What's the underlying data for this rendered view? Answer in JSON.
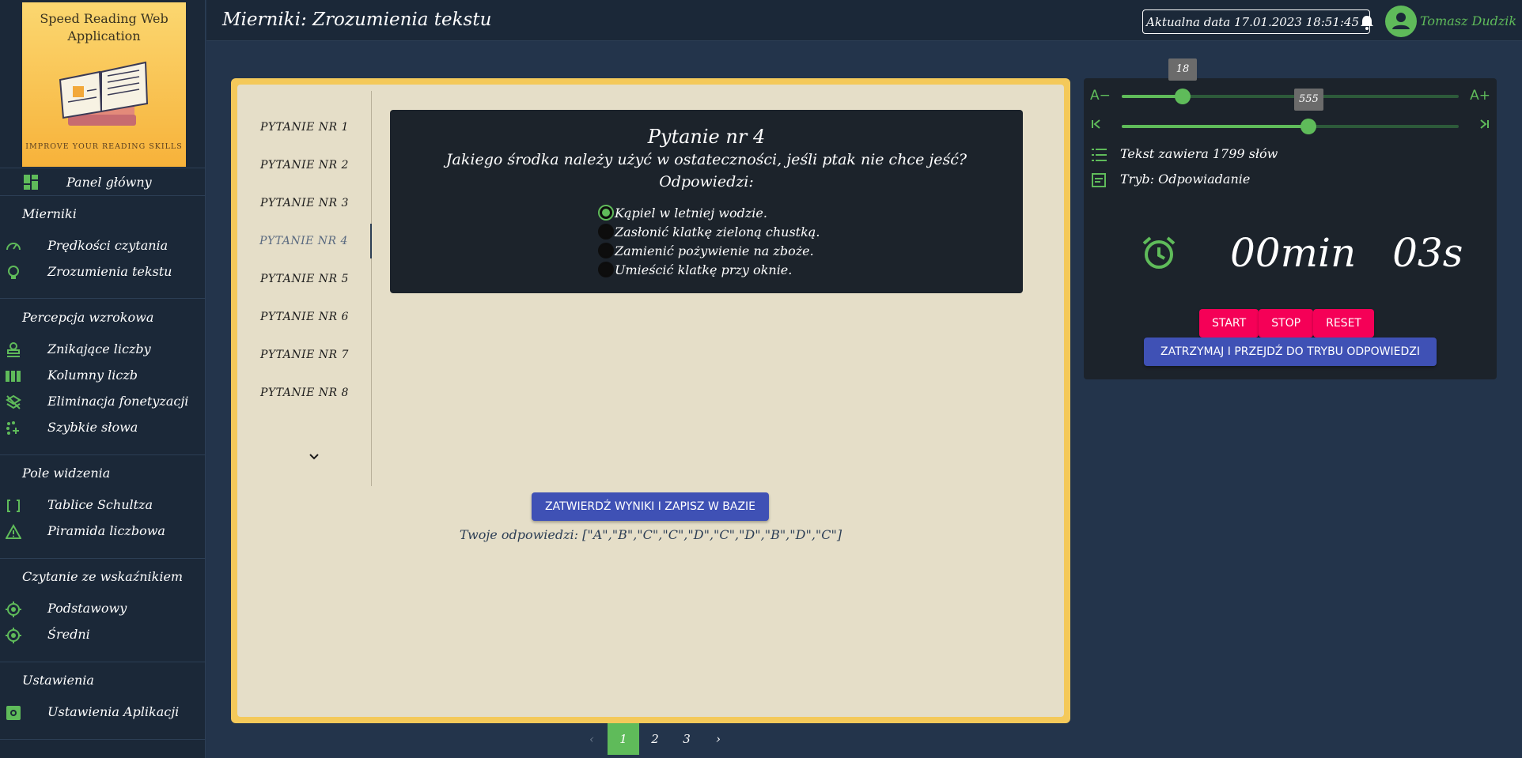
{
  "app": {
    "logo_title": "Speed Reading Web Application",
    "logo_tagline": "IMPROVE YOUR READING SKILLS"
  },
  "header": {
    "title": "Mierniki: Zrozumienia tekstu",
    "date_label": "Aktualna data 17.01.2023 18:51:45",
    "user_name": "Tomasz Dudzik"
  },
  "sidebar": {
    "main_label": "Panel główny",
    "sections": [
      {
        "title": "Mierniki",
        "items": [
          "Prędkości czytania",
          "Zrozumienia tekstu"
        ]
      },
      {
        "title": "Percepcja wzrokowa",
        "items": [
          "Znikające liczby",
          "Kolumny liczb",
          "Eliminacja fonetyzacji",
          "Szybkie słowa"
        ]
      },
      {
        "title": "Pole widzenia",
        "items": [
          "Tablice Schultza",
          "Piramida liczbowa"
        ]
      },
      {
        "title": "Czytanie ze wskaźnikiem",
        "items": [
          "Podstawowy",
          "Średni"
        ]
      },
      {
        "title": "Ustawienia",
        "items": [
          "Ustawienia Aplikacji"
        ]
      }
    ]
  },
  "questions": {
    "items": [
      "PYTANIE NR 1",
      "PYTANIE NR 2",
      "PYTANIE NR 3",
      "PYTANIE NR 4",
      "PYTANIE NR 5",
      "PYTANIE NR 6",
      "PYTANIE NR 7",
      "PYTANIE NR 8"
    ],
    "active_index": 3
  },
  "question_card": {
    "title": "Pytanie nr 4",
    "question": "Jakiego środka należy użyć w ostateczności, jeśli ptak nie chce jeść?",
    "answers_label": "Odpowiedzi:",
    "answers": [
      "Kąpiel w letniej wodzie.",
      "Zasłonić klatkę zieloną chustką.",
      "Zamienić pożywienie na zboże.",
      "Umieścić klatkę przy oknie."
    ],
    "selected_index": 0
  },
  "submit": {
    "button_label": "ZATWIERDŹ WYNIKI I ZAPISZ W BAZIE",
    "your_answers": "Twoje odpowiedzi: [\"A\",\"B\",\"C\",\"C\",\"D\",\"C\",\"D\",\"B\",\"D\",\"C\"]"
  },
  "pagination": {
    "pages": [
      "1",
      "2",
      "3"
    ],
    "active": "1",
    "prev": "‹",
    "next": "›"
  },
  "controls": {
    "font_minus": "A−",
    "font_plus": "A+",
    "font_size_value": "18",
    "font_size_fraction": 0.18,
    "speed_value": "555",
    "speed_fraction": 0.555,
    "speed_start": "|‹",
    "speed_end": "›|",
    "word_count": "Tekst zawiera 1799 słów",
    "mode": "Tryb: Odpowiadanie",
    "timer": "00min 03s",
    "start_label": "START",
    "stop_label": "STOP",
    "reset_label": "RESET",
    "stop_and_answer_label": "ZATRZYMAJ I PRZEJDŹ DO TRYBU ODPOWIEDZI"
  },
  "colors": {
    "accent": "#5fbb5a",
    "primary_button": "#3f51b5",
    "danger_button": "#f50057",
    "page_bg": "#23344b",
    "frame": "#f4c95a"
  }
}
